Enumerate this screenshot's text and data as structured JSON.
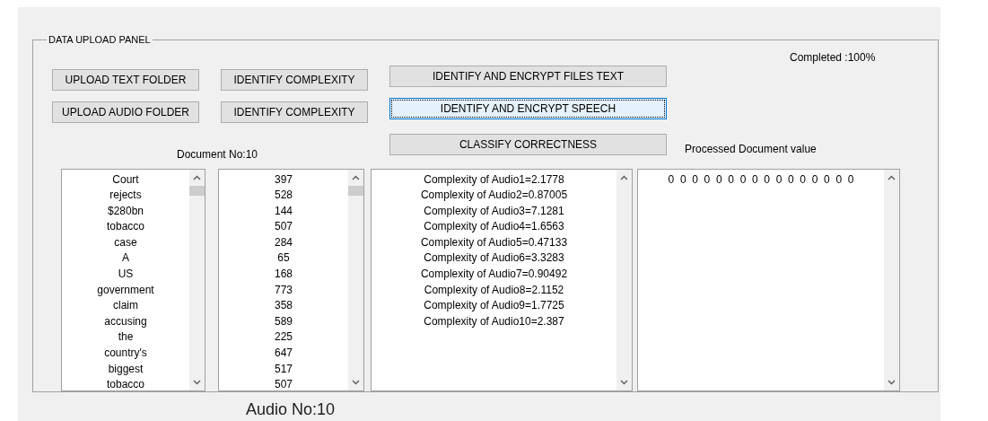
{
  "panel": {
    "title": "DATA UPLOAD PANEL",
    "button_columns": [
      [
        {
          "label": "UPLOAD TEXT FOLDER",
          "focused": false
        },
        {
          "label": "UPLOAD AUDIO FOLDER",
          "focused": false
        }
      ],
      [
        {
          "label": "IDENTIFY COMPLEXITY",
          "focused": false
        },
        {
          "label": "IDENTIFY COMPLEXITY",
          "focused": false
        }
      ],
      [
        {
          "label": "IDENTIFY AND ENCRYPT FILES TEXT",
          "focused": false
        },
        {
          "label": "IDENTIFY AND ENCRYPT SPEECH",
          "focused": true
        },
        {
          "label": "CLASSIFY CORRECTNESS",
          "focused": false
        }
      ]
    ],
    "progress_text": "Completed :100%",
    "document_label": "Document No:10",
    "processed_label": "Processed Document value",
    "lists": [
      {
        "items": [
          "Court",
          "rejects",
          "$280bn",
          "tobacco",
          "case",
          "A",
          "US",
          "government",
          "claim",
          "accusing",
          "the",
          "country's",
          "biggest",
          "tobacco"
        ]
      },
      {
        "items": [
          "397",
          "528",
          "144",
          "507",
          "284",
          "65",
          "168",
          "773",
          "358",
          "589",
          "225",
          "647",
          "517",
          "507"
        ]
      },
      {
        "items": [
          "Complexity of Audio1=2.1778",
          "Complexity of Audio2=0.87005",
          "Complexity of Audio3=7.1281",
          "Complexity of Audio4=1.6563",
          "Complexity of Audio5=0.47133",
          "Complexity of Audio6=3.3283",
          "Complexity of Audio7=0.90492",
          "Complexity of Audio8=2.1152",
          "Complexity of Audio9=1.7725",
          "Complexity of Audio10=2.387"
        ]
      },
      {
        "items": [
          "0  0  0  0  0  0  0  0  0  0  0  0  0  0  0  0"
        ]
      }
    ]
  },
  "audio_label": "Audio No:10"
}
